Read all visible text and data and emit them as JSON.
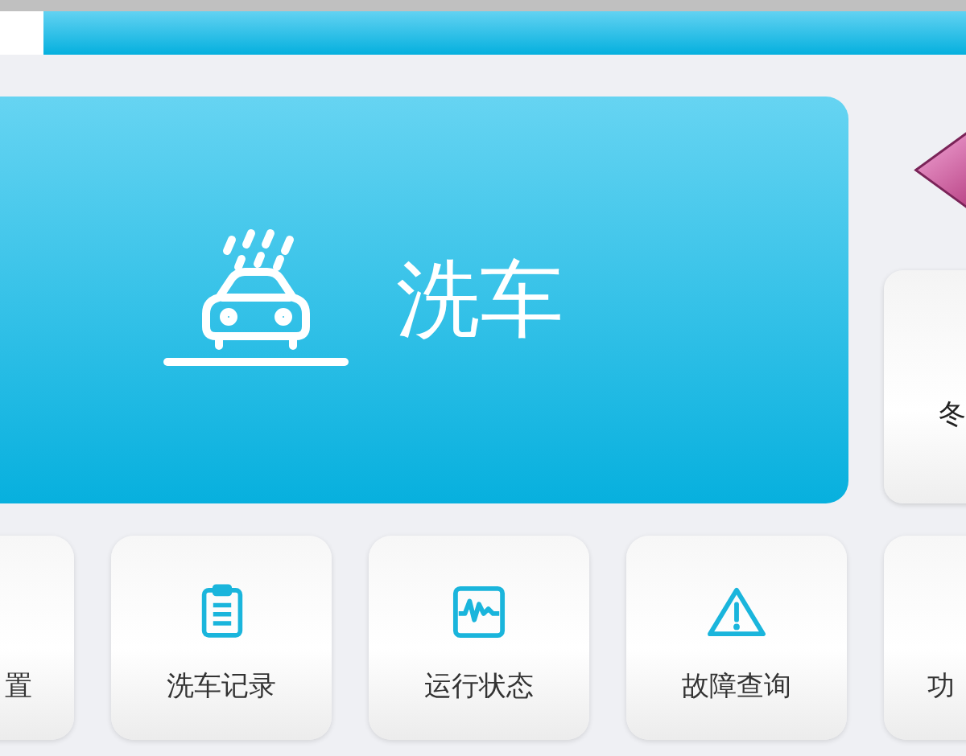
{
  "main_tile": {
    "label": "洗车"
  },
  "side_tile": {
    "label": "冬"
  },
  "tiles": [
    {
      "label": "置",
      "kind": "cut-left"
    },
    {
      "label": "洗车记录",
      "kind": "clipboard"
    },
    {
      "label": "运行状态",
      "kind": "monitor"
    },
    {
      "label": "故障查询",
      "kind": "warning"
    },
    {
      "label": "功",
      "kind": "cut-right"
    }
  ]
}
